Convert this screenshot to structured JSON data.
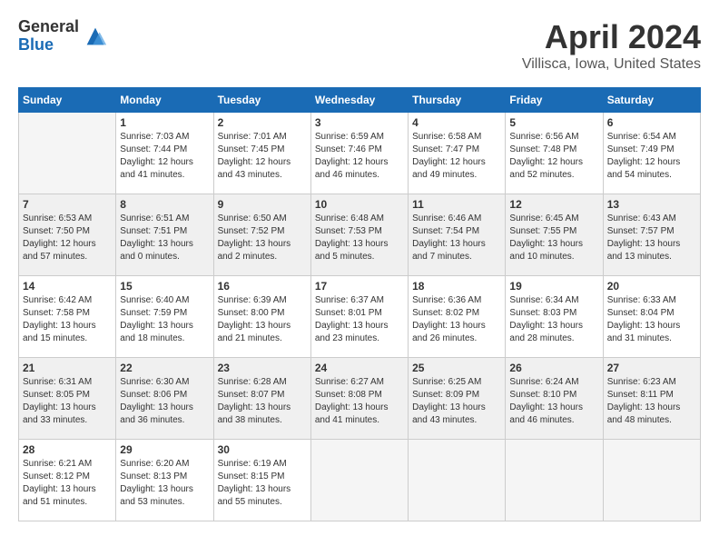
{
  "logo": {
    "general": "General",
    "blue": "Blue"
  },
  "title": {
    "month": "April 2024",
    "location": "Villisca, Iowa, United States"
  },
  "headers": [
    "Sunday",
    "Monday",
    "Tuesday",
    "Wednesday",
    "Thursday",
    "Friday",
    "Saturday"
  ],
  "weeks": [
    {
      "shaded": false,
      "days": [
        {
          "num": "",
          "sunrise": "",
          "sunset": "",
          "daylight": "",
          "empty": true
        },
        {
          "num": "1",
          "sunrise": "Sunrise: 7:03 AM",
          "sunset": "Sunset: 7:44 PM",
          "daylight": "Daylight: 12 hours and 41 minutes."
        },
        {
          "num": "2",
          "sunrise": "Sunrise: 7:01 AM",
          "sunset": "Sunset: 7:45 PM",
          "daylight": "Daylight: 12 hours and 43 minutes."
        },
        {
          "num": "3",
          "sunrise": "Sunrise: 6:59 AM",
          "sunset": "Sunset: 7:46 PM",
          "daylight": "Daylight: 12 hours and 46 minutes."
        },
        {
          "num": "4",
          "sunrise": "Sunrise: 6:58 AM",
          "sunset": "Sunset: 7:47 PM",
          "daylight": "Daylight: 12 hours and 49 minutes."
        },
        {
          "num": "5",
          "sunrise": "Sunrise: 6:56 AM",
          "sunset": "Sunset: 7:48 PM",
          "daylight": "Daylight: 12 hours and 52 minutes."
        },
        {
          "num": "6",
          "sunrise": "Sunrise: 6:54 AM",
          "sunset": "Sunset: 7:49 PM",
          "daylight": "Daylight: 12 hours and 54 minutes."
        }
      ]
    },
    {
      "shaded": true,
      "days": [
        {
          "num": "7",
          "sunrise": "Sunrise: 6:53 AM",
          "sunset": "Sunset: 7:50 PM",
          "daylight": "Daylight: 12 hours and 57 minutes."
        },
        {
          "num": "8",
          "sunrise": "Sunrise: 6:51 AM",
          "sunset": "Sunset: 7:51 PM",
          "daylight": "Daylight: 13 hours and 0 minutes."
        },
        {
          "num": "9",
          "sunrise": "Sunrise: 6:50 AM",
          "sunset": "Sunset: 7:52 PM",
          "daylight": "Daylight: 13 hours and 2 minutes."
        },
        {
          "num": "10",
          "sunrise": "Sunrise: 6:48 AM",
          "sunset": "Sunset: 7:53 PM",
          "daylight": "Daylight: 13 hours and 5 minutes."
        },
        {
          "num": "11",
          "sunrise": "Sunrise: 6:46 AM",
          "sunset": "Sunset: 7:54 PM",
          "daylight": "Daylight: 13 hours and 7 minutes."
        },
        {
          "num": "12",
          "sunrise": "Sunrise: 6:45 AM",
          "sunset": "Sunset: 7:55 PM",
          "daylight": "Daylight: 13 hours and 10 minutes."
        },
        {
          "num": "13",
          "sunrise": "Sunrise: 6:43 AM",
          "sunset": "Sunset: 7:57 PM",
          "daylight": "Daylight: 13 hours and 13 minutes."
        }
      ]
    },
    {
      "shaded": false,
      "days": [
        {
          "num": "14",
          "sunrise": "Sunrise: 6:42 AM",
          "sunset": "Sunset: 7:58 PM",
          "daylight": "Daylight: 13 hours and 15 minutes."
        },
        {
          "num": "15",
          "sunrise": "Sunrise: 6:40 AM",
          "sunset": "Sunset: 7:59 PM",
          "daylight": "Daylight: 13 hours and 18 minutes."
        },
        {
          "num": "16",
          "sunrise": "Sunrise: 6:39 AM",
          "sunset": "Sunset: 8:00 PM",
          "daylight": "Daylight: 13 hours and 21 minutes."
        },
        {
          "num": "17",
          "sunrise": "Sunrise: 6:37 AM",
          "sunset": "Sunset: 8:01 PM",
          "daylight": "Daylight: 13 hours and 23 minutes."
        },
        {
          "num": "18",
          "sunrise": "Sunrise: 6:36 AM",
          "sunset": "Sunset: 8:02 PM",
          "daylight": "Daylight: 13 hours and 26 minutes."
        },
        {
          "num": "19",
          "sunrise": "Sunrise: 6:34 AM",
          "sunset": "Sunset: 8:03 PM",
          "daylight": "Daylight: 13 hours and 28 minutes."
        },
        {
          "num": "20",
          "sunrise": "Sunrise: 6:33 AM",
          "sunset": "Sunset: 8:04 PM",
          "daylight": "Daylight: 13 hours and 31 minutes."
        }
      ]
    },
    {
      "shaded": true,
      "days": [
        {
          "num": "21",
          "sunrise": "Sunrise: 6:31 AM",
          "sunset": "Sunset: 8:05 PM",
          "daylight": "Daylight: 13 hours and 33 minutes."
        },
        {
          "num": "22",
          "sunrise": "Sunrise: 6:30 AM",
          "sunset": "Sunset: 8:06 PM",
          "daylight": "Daylight: 13 hours and 36 minutes."
        },
        {
          "num": "23",
          "sunrise": "Sunrise: 6:28 AM",
          "sunset": "Sunset: 8:07 PM",
          "daylight": "Daylight: 13 hours and 38 minutes."
        },
        {
          "num": "24",
          "sunrise": "Sunrise: 6:27 AM",
          "sunset": "Sunset: 8:08 PM",
          "daylight": "Daylight: 13 hours and 41 minutes."
        },
        {
          "num": "25",
          "sunrise": "Sunrise: 6:25 AM",
          "sunset": "Sunset: 8:09 PM",
          "daylight": "Daylight: 13 hours and 43 minutes."
        },
        {
          "num": "26",
          "sunrise": "Sunrise: 6:24 AM",
          "sunset": "Sunset: 8:10 PM",
          "daylight": "Daylight: 13 hours and 46 minutes."
        },
        {
          "num": "27",
          "sunrise": "Sunrise: 6:23 AM",
          "sunset": "Sunset: 8:11 PM",
          "daylight": "Daylight: 13 hours and 48 minutes."
        }
      ]
    },
    {
      "shaded": false,
      "days": [
        {
          "num": "28",
          "sunrise": "Sunrise: 6:21 AM",
          "sunset": "Sunset: 8:12 PM",
          "daylight": "Daylight: 13 hours and 51 minutes."
        },
        {
          "num": "29",
          "sunrise": "Sunrise: 6:20 AM",
          "sunset": "Sunset: 8:13 PM",
          "daylight": "Daylight: 13 hours and 53 minutes."
        },
        {
          "num": "30",
          "sunrise": "Sunrise: 6:19 AM",
          "sunset": "Sunset: 8:15 PM",
          "daylight": "Daylight: 13 hours and 55 minutes."
        },
        {
          "num": "",
          "sunrise": "",
          "sunset": "",
          "daylight": "",
          "empty": true
        },
        {
          "num": "",
          "sunrise": "",
          "sunset": "",
          "daylight": "",
          "empty": true
        },
        {
          "num": "",
          "sunrise": "",
          "sunset": "",
          "daylight": "",
          "empty": true
        },
        {
          "num": "",
          "sunrise": "",
          "sunset": "",
          "daylight": "",
          "empty": true
        }
      ]
    }
  ]
}
